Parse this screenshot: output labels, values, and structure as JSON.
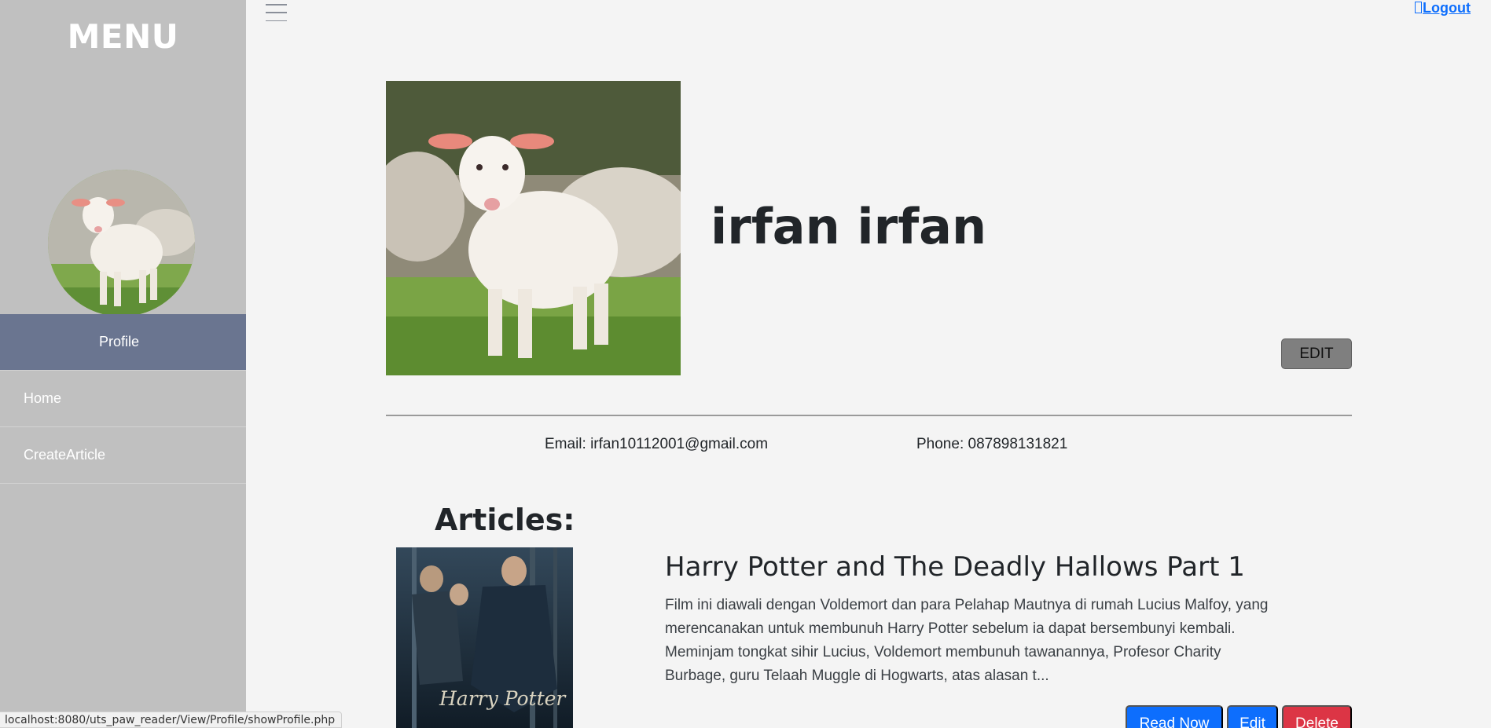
{
  "sidebar": {
    "title": "MENU",
    "avatar_alt": "lamb-photo",
    "items": [
      {
        "label": "Profile",
        "active": true
      },
      {
        "label": "Home",
        "active": false
      },
      {
        "label": "CreateArticle",
        "active": false
      }
    ]
  },
  "topbar": {
    "menu_icon": "hamburger-icon",
    "logout_label": "Logout"
  },
  "profile": {
    "name": "irfan irfan",
    "edit_label": "EDIT",
    "email_text": "Email: irfan10112001@gmail.com",
    "phone_text": "Phone: 087898131821"
  },
  "articles": {
    "heading": "Articles:",
    "items": [
      {
        "title": "Harry Potter and The Deadly Hallows Part 1",
        "excerpt": "Film ini diawali dengan Voldemort dan para Pelahap Mautnya di rumah Lucius Malfoy, yang merencanakan untuk membunuh Harry Potter sebelum ia dapat bersembunyi kembali. Meminjam tongkat sihir Lucius, Voldemort membunuh tawanannya, Profesor Charity Burbage, guru Telaah Muggle di Hogwarts, atas alasan t...",
        "cover_text": "Harry Potter",
        "read_label": "Read Now",
        "edit_label": "Edit",
        "delete_label": "Delete"
      }
    ]
  },
  "status_url": "localhost:8080/uts_paw_reader/View/Profile/showProfile.php",
  "colors": {
    "sidebar_bg": "#c0c0c0",
    "nav_active_bg": "#6a7590",
    "page_bg": "#f4f4f4",
    "primary": "#0d6efd",
    "danger": "#dc3545",
    "edit_profile_bg": "#7f7f7f"
  }
}
